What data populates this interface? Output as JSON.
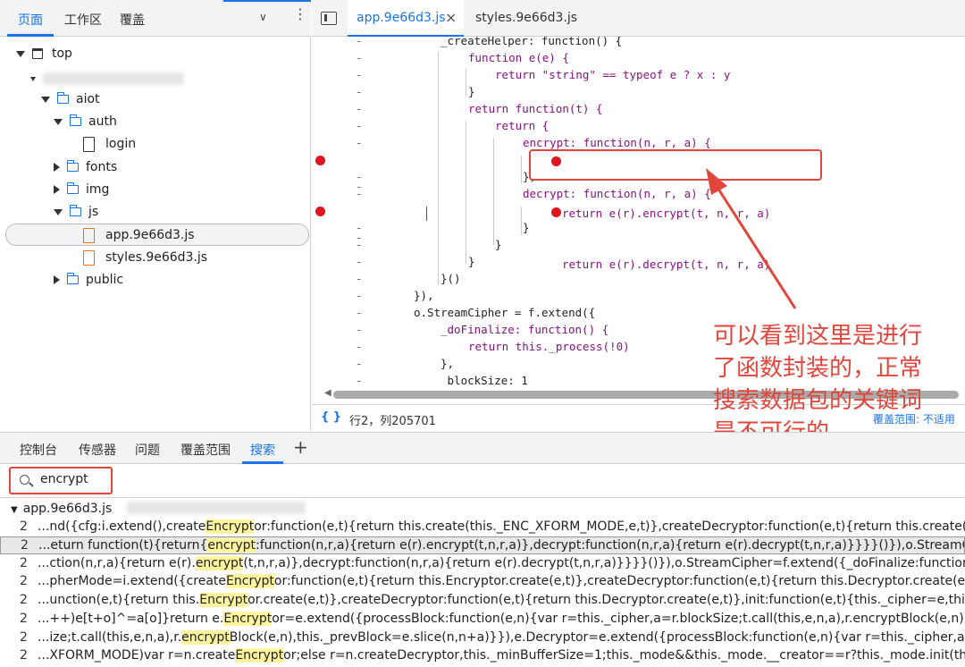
{
  "left_panel": {
    "tabs": [
      "页面",
      "工作区",
      "覆盖"
    ],
    "tree": {
      "top": "top",
      "aiot": "aiot",
      "auth": "auth",
      "login": "login",
      "fonts": "fonts",
      "img": "img",
      "js": "js",
      "app_js": "app.9e66d3.js",
      "styles_js": "styles.9e66d3.js",
      "public": "public"
    }
  },
  "editor": {
    "tabs": [
      "app.9e66d3.js",
      "styles.9e66d3.js"
    ],
    "close_icon": "×",
    "status": "行2，列205701",
    "status_braces": "{ }",
    "coverage": "覆盖范围: 不适用",
    "lines": [
      "_createHelper: function() {",
      "function e(e) {",
      "return \"string\" == typeof e ? x : y",
      "}",
      "return function(t) {",
      "return {",
      "encrypt: function(n, r, a) {",
      "return e(r).encrypt(t, n, r, a)",
      "},",
      "decrypt: function(n, r, a) {",
      "return e(r).decrypt(t, n, r, a)",
      "}",
      "}",
      "}",
      "}()",
      "}),",
      "o.StreamCipher = f.extend({",
      "_doFinalize: function() {",
      "return this._process(!0)",
      "},",
      "_blockSize: 1"
    ]
  },
  "annotation": [
    "可以看到这里是进行",
    "了函数封装的，正常",
    "搜索数据包的关键词",
    "是不可行的"
  ],
  "bottom_panel": {
    "tabs": [
      "控制台",
      "传感器",
      "问题",
      "覆盖范围",
      "搜索"
    ],
    "plus": "+",
    "search_value": "encrypt",
    "result_file": "app.9e66d3.js",
    "results": [
      {
        "line": "2",
        "pre": "...nd({cfg:i.extend(),create",
        "match": "Encrypt",
        "post": "or:function(e,t){return this.create(this._ENC_XFORM_MODE,e,t)},createDecryptor:function(e,t){return this.create(this._DEC_XFORM_"
      },
      {
        "line": "2",
        "pre": "...eturn function(t){return{",
        "match": "encrypt",
        "post": ":function(n,r,a){return e(r).encrypt(t,n,r,a)},decrypt:function(n,r,a){return e(r).decrypt(t,n,r,a)}}}}()}),o.StreamCipher=f.extend({_do"
      },
      {
        "line": "2",
        "pre": "...ction(n,r,a){return e(r).",
        "match": "encrypt",
        "post": "(t,n,r,a)},decrypt:function(n,r,a){return e(r).decrypt(t,n,r,a)}}}}()}),o.StreamCipher=f.extend({_doFinalize:function(){return this._proce"
      },
      {
        "line": "2",
        "pre": "...pherMode=i.extend({create",
        "match": "Encrypt",
        "post": "or:function(e,t){return this.Encryptor.create(e,t)},createDecryptor:function(e,t){return this.Decryptor.create(e,t)},init:function"
      },
      {
        "line": "2",
        "pre": "...unction(e,t){return this.",
        "match": "Encrypt",
        "post": "or.create(e,t)},createDecryptor:function(e,t){return this.Decryptor.create(e,t)},init:function(e,t){this._cipher=e,this._iv=t}}),m=p.CB"
      },
      {
        "line": "2",
        "pre": "...++)e[t+o]^=a[o]}return e.",
        "match": "Encrypt",
        "post": "or=e.extend({processBlock:function(e,n){var r=this._cipher,a=r.blockSize;t.call(this,e,n,a),r.encryptBlock(e,n),this._prevBlock=e.sl"
      },
      {
        "line": "2",
        "pre": "...ize;t.call(this,e,n,a),r.",
        "match": "encrypt",
        "post": "Block(e,n),this._prevBlock=e.slice(n,n+a)}}),e.Decryptor=e.extend({processBlock:function(e,n){var r=this._cipher,a=r.blockSize,o=e.sl"
      },
      {
        "line": "2",
        "pre": "...XFORM_MODE)var r=n.create",
        "match": "Encrypt",
        "post": "or;else r=n.createDecryptor,this._minBufferSize=1;this._mode&&this._mode.__creator==r?this._mode.init(this,t&&t.words):this"
      }
    ]
  }
}
